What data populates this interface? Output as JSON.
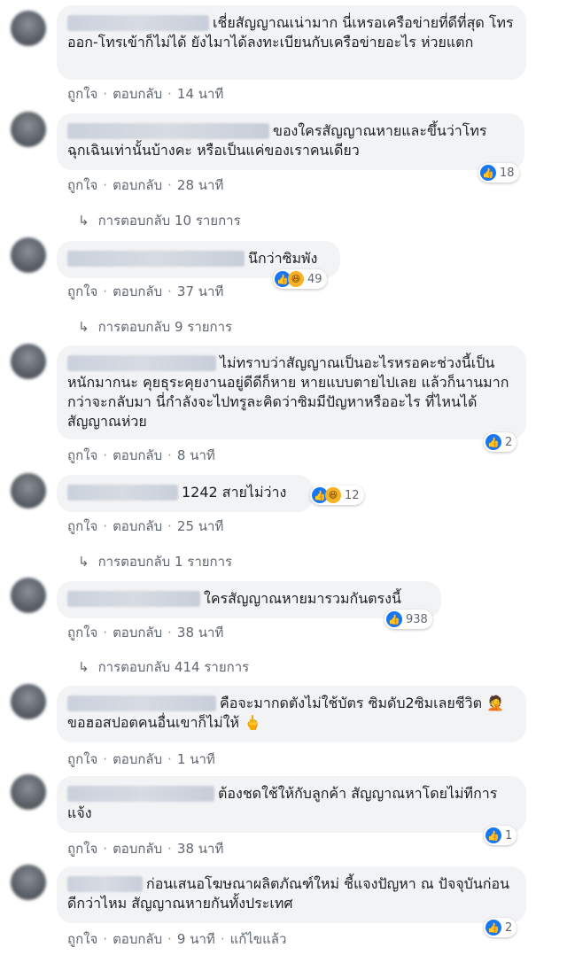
{
  "action_labels": {
    "like": "ถูกใจ",
    "reply": "ตอบกลับ",
    "dot": "·",
    "edited": "แก้ไขแล้ว"
  },
  "reply_arrow": "↳",
  "comments": [
    {
      "text": "เชี่ยสัญญาณเน่ามาก นี่เหรอเครือข่ายที่ดีที่สุด โทรออก-โทรเข้าก็ไม่ได้ ยังไมาได้ลงทะเบียนกับเครือข่ายอะไร ห่วยแตก",
      "time": "14 นาที"
    },
    {
      "text": "ของใครสัญญาณหายและขึ้นว่าโทรฉุกเฉินเท่านั้นบ้างคะ หรือเป็นแค่ของเราคนเดียว",
      "time": "28 นาที",
      "reaction_count": "18",
      "replies": "การตอบกลับ 10 รายการ"
    },
    {
      "text": "นึกว่าซิมพัง",
      "time": "37 นาที",
      "reaction_count": "49",
      "replies": "การตอบกลับ 9 รายการ"
    },
    {
      "text": "ไม่ทราบว่าสัญญาณเป็นอะไรหรอคะช่วงนี้เป็นหนักมากนะ คุยธุระคุยงานอยู่ดีดีก็หาย หายแบบตายไปเลย แล้วก็นานมาก กว่าจะกลับมา นี่กำลังจะไปทรูละคิดว่าซิมมีปัญหาหรืออะไร ที่ไหนได้สัญญาณห่วย",
      "time": "8 นาที",
      "reaction_count": "2"
    },
    {
      "text": "1242 สายไม่ว่าง",
      "time": "25 นาที",
      "reaction_count": "12",
      "replies": "การตอบกลับ 1 รายการ"
    },
    {
      "text": "ใครสัญญาณหายมารวมกันตรงนี้",
      "time": "38 นาที",
      "reaction_count": "938",
      "replies": "การตอบกลับ 414 รายการ"
    },
    {
      "text": "คือจะมากดตังไม่ใช้บัตร ซิมดับ2ซิมเลยชีวิต 🤦 ขอฮอสปอตคนอื่นเขาก็ไม่ให้ 🖕",
      "time": "1 นาที"
    },
    {
      "text": "ต้องชดใช้ให้กับลูกค้า สัญญาณหาโดยไม่ทีการแจ้ง",
      "time": "38 นาที",
      "reaction_count": "1"
    },
    {
      "text": "ก่อนเสนอโฆษณาผลิตภัณฑ์ใหม่ ชี้แจงปัญหา ณ ปัจจุบันก่อนดีกว่าไหม สัญญาณหายกันทั้งประเทศ",
      "time": "9 นาที",
      "reaction_count": "2"
    }
  ]
}
